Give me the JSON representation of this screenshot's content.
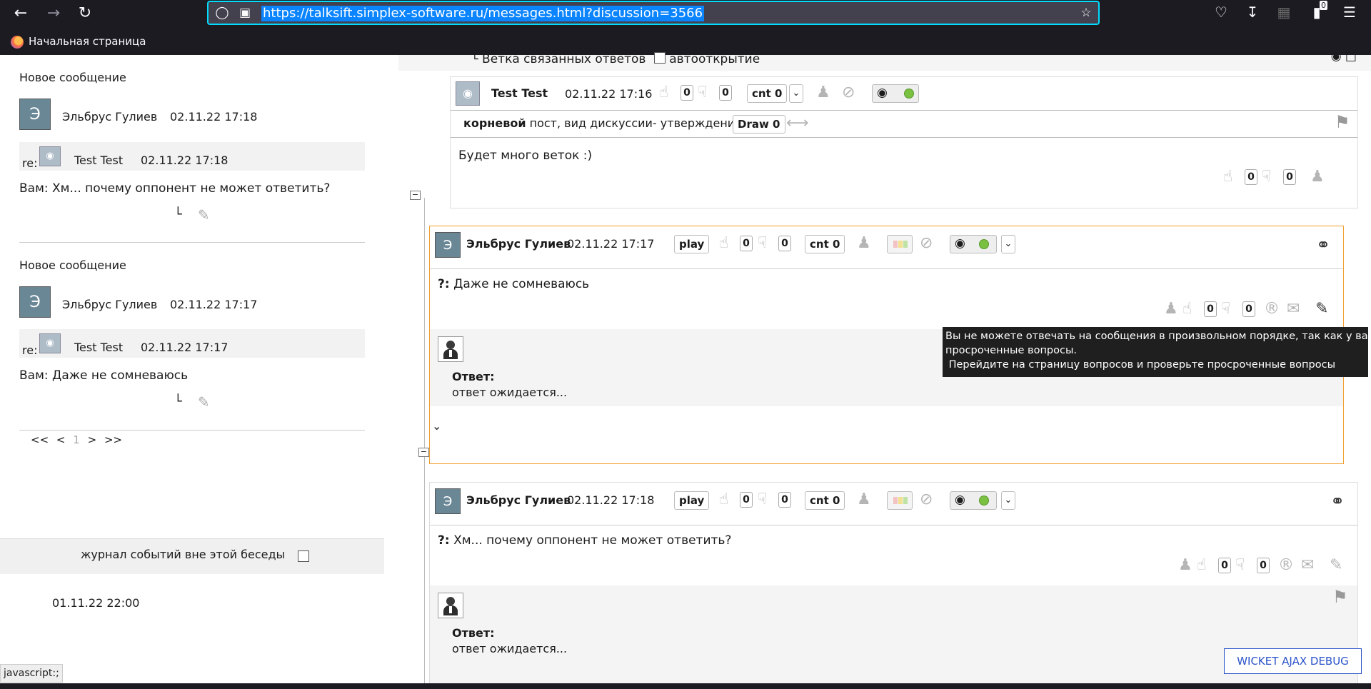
{
  "browser": {
    "url": "https://talksift.simplex-software.ru/messages.html?discussion=3566",
    "bookmark": "Начальная страница",
    "addon_badge": "0"
  },
  "notifications": [
    {
      "title": "Новое сообщение",
      "avatar_letter": "Э",
      "author": "Эльбрус Гулиев",
      "date": "02.11.22 17:18",
      "re_label": "re:",
      "re_author": "Test Test",
      "re_date": "02.11.22 17:18",
      "text": "Вам: Хм... почему оппонент не может ответить?"
    },
    {
      "title": "Новое сообщение",
      "avatar_letter": "Э",
      "author": "Эльбрус Гулиев",
      "date": "02.11.22 17:17",
      "re_label": "re:",
      "re_author": "Test Test",
      "re_date": "02.11.22 17:17",
      "text": "Вам: Даже не сомневаюсь"
    }
  ],
  "pager": {
    "first": "<<",
    "prev": "<",
    "current": "1",
    "next": ">",
    "last": ">>"
  },
  "journal": {
    "label": "журнал событий вне этой беседы",
    "date": "01.11.22 22:00"
  },
  "status_bar": "javascript:;",
  "branch_header": {
    "label": "Ветка связанных ответов",
    "autoopen": "автооткрытие"
  },
  "root_post": {
    "author": "Test Test",
    "date": "02.11.22 17:16",
    "likes": "0",
    "dislikes": "0",
    "cnt": "cnt 0",
    "root_bold": "корневой",
    "root_rest": " пост, вид дискуссии- утверждение",
    "draw": "Draw 0",
    "text": "Будет много веток :)",
    "bottom_likes": "0",
    "bottom_dislikes": "0"
  },
  "posts": [
    {
      "avatar_letter": "Э",
      "author": "Эльбрус Гулиев",
      "date": "02.11.22 17:17",
      "play": "play",
      "likes": "0",
      "dislikes": "0",
      "cnt": "cnt 0",
      "q_prefix": "?:",
      "text": " Даже не сомневаюсь",
      "bottom_likes": "0",
      "bottom_dislikes": "0",
      "answer_label": "Ответ:",
      "answer_text": "ответ ожидается..."
    },
    {
      "avatar_letter": "Э",
      "author": "Эльбрус Гулиев",
      "date": "02.11.22 17:18",
      "play": "play",
      "likes": "0",
      "dislikes": "0",
      "cnt": "cnt 0",
      "q_prefix": "?:",
      "text": " Хм... почему оппонент не может ответить?",
      "bottom_likes": "0",
      "bottom_dislikes": "0",
      "answer_label": "Ответ:",
      "answer_text": "ответ ожидается..."
    }
  ],
  "tooltip": {
    "line1": "Вы не можете отвечать на сообщения в произвольном порядке, так как у вас есть",
    "line2": "просроченные вопросы.",
    "line3": " Перейдите на страницу вопросов и проверьте просроченные вопросы"
  },
  "wicket_debug": "WICKET AJAX DEBUG"
}
